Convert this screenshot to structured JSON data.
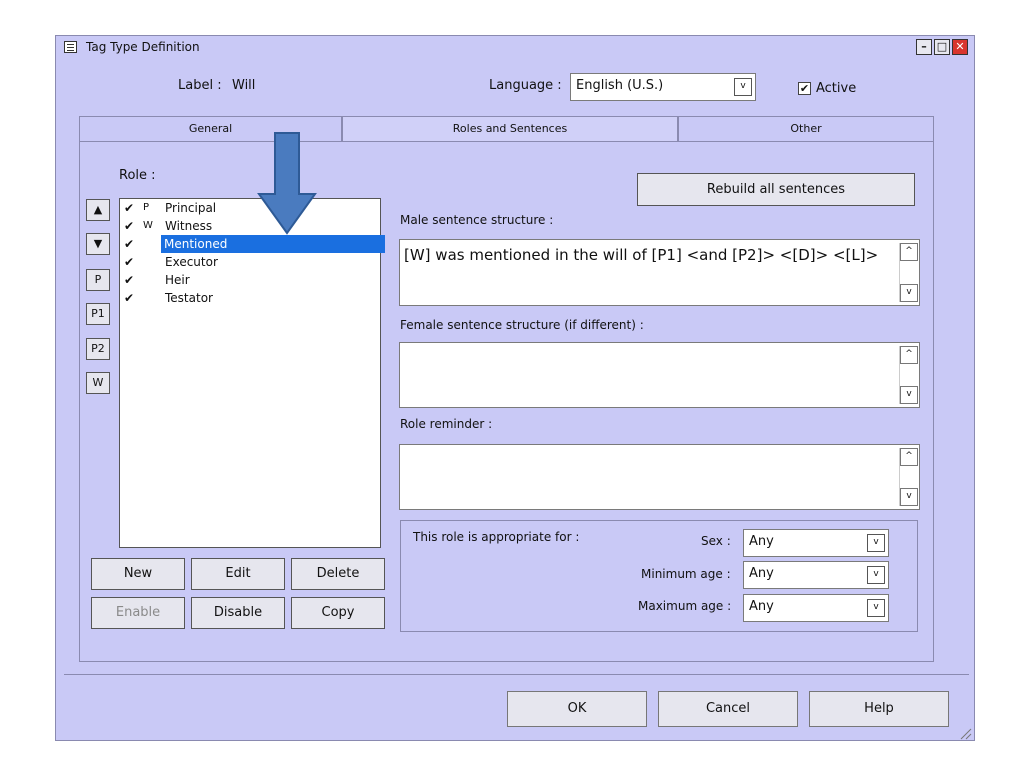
{
  "window": {
    "title": "Tag Type Definition",
    "controls": {
      "minimize": "–",
      "maximize": "□",
      "close": "✕"
    }
  },
  "header": {
    "label_caption": "Label :",
    "label_value": "Will",
    "language_caption": "Language :",
    "language_value": "English (U.S.)",
    "active_label": "Active",
    "active_checked": true,
    "check_glyph": "✔"
  },
  "tabs": [
    {
      "label": "General",
      "active": false
    },
    {
      "label": "Roles and Sentences",
      "active": true
    },
    {
      "label": "Other",
      "active": false
    }
  ],
  "roles": {
    "caption": "Role :",
    "side_buttons": [
      "▲",
      "▼",
      "P",
      "P1",
      "P2",
      "W"
    ],
    "items": [
      {
        "check": "✔",
        "code": "P",
        "name": "Principal"
      },
      {
        "check": "✔",
        "code": "W",
        "name": "Witness"
      },
      {
        "check": "✔",
        "code": "",
        "name": "Mentioned",
        "selected": true
      },
      {
        "check": "✔",
        "code": "",
        "name": "Executor"
      },
      {
        "check": "✔",
        "code": "",
        "name": "Heir"
      },
      {
        "check": "✔",
        "code": "",
        "name": "Testator"
      }
    ],
    "buttons": {
      "new": "New",
      "edit": "Edit",
      "delete": "Delete",
      "enable": "Enable",
      "disable": "Disable",
      "copy": "Copy"
    }
  },
  "sentences": {
    "rebuild_label": "Rebuild all sentences",
    "male_caption": "Male sentence structure :",
    "male_value": "[W] was mentioned in the will of [P1] <and [P2]> <[D]> <[L]>",
    "female_caption": "Female sentence structure (if different) :",
    "female_value": "",
    "reminder_caption": "Role reminder :",
    "reminder_value": ""
  },
  "appropriate": {
    "caption": "This role is appropriate for :",
    "sex_caption": "Sex :",
    "sex_value": "Any",
    "min_caption": "Minimum age :",
    "min_value": "Any",
    "max_caption": "Maximum age :",
    "max_value": "Any"
  },
  "footer": {
    "ok": "OK",
    "cancel": "Cancel",
    "help": "Help"
  },
  "icons": {
    "scroll_up": "^",
    "scroll_down": "v",
    "dropdown": "v"
  },
  "colors": {
    "window_bg": "#c9c9f6",
    "selection": "#1a6fe0",
    "annotation_arrow": "#4a7bbf"
  }
}
